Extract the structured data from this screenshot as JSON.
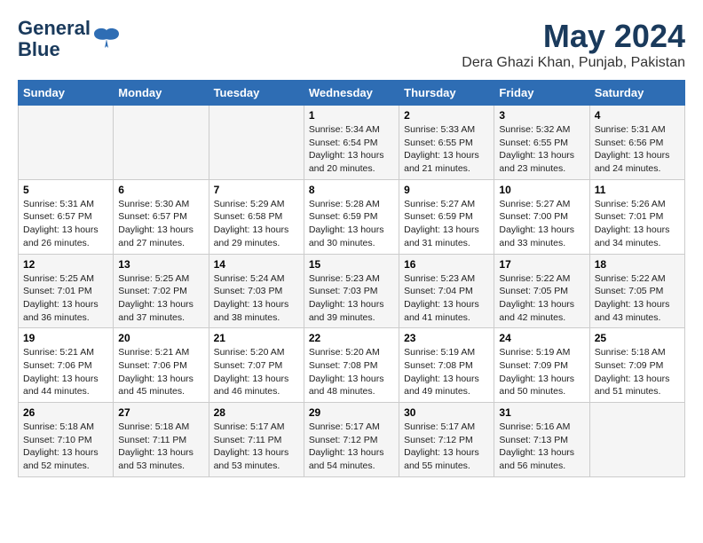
{
  "header": {
    "logo_line1": "General",
    "logo_line2": "Blue",
    "title": "May 2024",
    "subtitle": "Dera Ghazi Khan, Punjab, Pakistan"
  },
  "days_of_week": [
    "Sunday",
    "Monday",
    "Tuesday",
    "Wednesday",
    "Thursday",
    "Friday",
    "Saturday"
  ],
  "weeks": [
    [
      {
        "day": "",
        "sunrise": "",
        "sunset": "",
        "daylight": ""
      },
      {
        "day": "",
        "sunrise": "",
        "sunset": "",
        "daylight": ""
      },
      {
        "day": "",
        "sunrise": "",
        "sunset": "",
        "daylight": ""
      },
      {
        "day": "1",
        "sunrise": "Sunrise: 5:34 AM",
        "sunset": "Sunset: 6:54 PM",
        "daylight": "Daylight: 13 hours and 20 minutes."
      },
      {
        "day": "2",
        "sunrise": "Sunrise: 5:33 AM",
        "sunset": "Sunset: 6:55 PM",
        "daylight": "Daylight: 13 hours and 21 minutes."
      },
      {
        "day": "3",
        "sunrise": "Sunrise: 5:32 AM",
        "sunset": "Sunset: 6:55 PM",
        "daylight": "Daylight: 13 hours and 23 minutes."
      },
      {
        "day": "4",
        "sunrise": "Sunrise: 5:31 AM",
        "sunset": "Sunset: 6:56 PM",
        "daylight": "Daylight: 13 hours and 24 minutes."
      }
    ],
    [
      {
        "day": "5",
        "sunrise": "Sunrise: 5:31 AM",
        "sunset": "Sunset: 6:57 PM",
        "daylight": "Daylight: 13 hours and 26 minutes."
      },
      {
        "day": "6",
        "sunrise": "Sunrise: 5:30 AM",
        "sunset": "Sunset: 6:57 PM",
        "daylight": "Daylight: 13 hours and 27 minutes."
      },
      {
        "day": "7",
        "sunrise": "Sunrise: 5:29 AM",
        "sunset": "Sunset: 6:58 PM",
        "daylight": "Daylight: 13 hours and 29 minutes."
      },
      {
        "day": "8",
        "sunrise": "Sunrise: 5:28 AM",
        "sunset": "Sunset: 6:59 PM",
        "daylight": "Daylight: 13 hours and 30 minutes."
      },
      {
        "day": "9",
        "sunrise": "Sunrise: 5:27 AM",
        "sunset": "Sunset: 6:59 PM",
        "daylight": "Daylight: 13 hours and 31 minutes."
      },
      {
        "day": "10",
        "sunrise": "Sunrise: 5:27 AM",
        "sunset": "Sunset: 7:00 PM",
        "daylight": "Daylight: 13 hours and 33 minutes."
      },
      {
        "day": "11",
        "sunrise": "Sunrise: 5:26 AM",
        "sunset": "Sunset: 7:01 PM",
        "daylight": "Daylight: 13 hours and 34 minutes."
      }
    ],
    [
      {
        "day": "12",
        "sunrise": "Sunrise: 5:25 AM",
        "sunset": "Sunset: 7:01 PM",
        "daylight": "Daylight: 13 hours and 36 minutes."
      },
      {
        "day": "13",
        "sunrise": "Sunrise: 5:25 AM",
        "sunset": "Sunset: 7:02 PM",
        "daylight": "Daylight: 13 hours and 37 minutes."
      },
      {
        "day": "14",
        "sunrise": "Sunrise: 5:24 AM",
        "sunset": "Sunset: 7:03 PM",
        "daylight": "Daylight: 13 hours and 38 minutes."
      },
      {
        "day": "15",
        "sunrise": "Sunrise: 5:23 AM",
        "sunset": "Sunset: 7:03 PM",
        "daylight": "Daylight: 13 hours and 39 minutes."
      },
      {
        "day": "16",
        "sunrise": "Sunrise: 5:23 AM",
        "sunset": "Sunset: 7:04 PM",
        "daylight": "Daylight: 13 hours and 41 minutes."
      },
      {
        "day": "17",
        "sunrise": "Sunrise: 5:22 AM",
        "sunset": "Sunset: 7:05 PM",
        "daylight": "Daylight: 13 hours and 42 minutes."
      },
      {
        "day": "18",
        "sunrise": "Sunrise: 5:22 AM",
        "sunset": "Sunset: 7:05 PM",
        "daylight": "Daylight: 13 hours and 43 minutes."
      }
    ],
    [
      {
        "day": "19",
        "sunrise": "Sunrise: 5:21 AM",
        "sunset": "Sunset: 7:06 PM",
        "daylight": "Daylight: 13 hours and 44 minutes."
      },
      {
        "day": "20",
        "sunrise": "Sunrise: 5:21 AM",
        "sunset": "Sunset: 7:06 PM",
        "daylight": "Daylight: 13 hours and 45 minutes."
      },
      {
        "day": "21",
        "sunrise": "Sunrise: 5:20 AM",
        "sunset": "Sunset: 7:07 PM",
        "daylight": "Daylight: 13 hours and 46 minutes."
      },
      {
        "day": "22",
        "sunrise": "Sunrise: 5:20 AM",
        "sunset": "Sunset: 7:08 PM",
        "daylight": "Daylight: 13 hours and 48 minutes."
      },
      {
        "day": "23",
        "sunrise": "Sunrise: 5:19 AM",
        "sunset": "Sunset: 7:08 PM",
        "daylight": "Daylight: 13 hours and 49 minutes."
      },
      {
        "day": "24",
        "sunrise": "Sunrise: 5:19 AM",
        "sunset": "Sunset: 7:09 PM",
        "daylight": "Daylight: 13 hours and 50 minutes."
      },
      {
        "day": "25",
        "sunrise": "Sunrise: 5:18 AM",
        "sunset": "Sunset: 7:09 PM",
        "daylight": "Daylight: 13 hours and 51 minutes."
      }
    ],
    [
      {
        "day": "26",
        "sunrise": "Sunrise: 5:18 AM",
        "sunset": "Sunset: 7:10 PM",
        "daylight": "Daylight: 13 hours and 52 minutes."
      },
      {
        "day": "27",
        "sunrise": "Sunrise: 5:18 AM",
        "sunset": "Sunset: 7:11 PM",
        "daylight": "Daylight: 13 hours and 53 minutes."
      },
      {
        "day": "28",
        "sunrise": "Sunrise: 5:17 AM",
        "sunset": "Sunset: 7:11 PM",
        "daylight": "Daylight: 13 hours and 53 minutes."
      },
      {
        "day": "29",
        "sunrise": "Sunrise: 5:17 AM",
        "sunset": "Sunset: 7:12 PM",
        "daylight": "Daylight: 13 hours and 54 minutes."
      },
      {
        "day": "30",
        "sunrise": "Sunrise: 5:17 AM",
        "sunset": "Sunset: 7:12 PM",
        "daylight": "Daylight: 13 hours and 55 minutes."
      },
      {
        "day": "31",
        "sunrise": "Sunrise: 5:16 AM",
        "sunset": "Sunset: 7:13 PM",
        "daylight": "Daylight: 13 hours and 56 minutes."
      },
      {
        "day": "",
        "sunrise": "",
        "sunset": "",
        "daylight": ""
      }
    ]
  ]
}
